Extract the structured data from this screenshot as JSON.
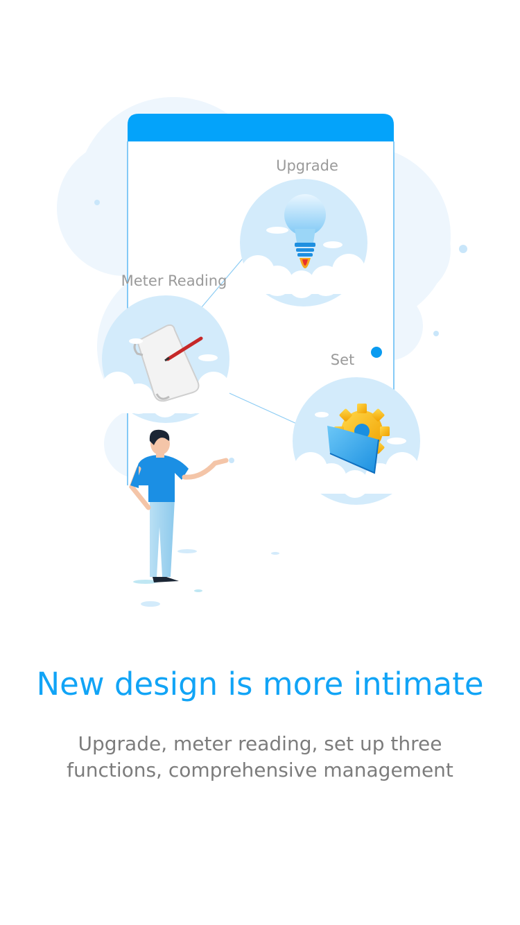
{
  "features": {
    "upgrade": {
      "label": "Upgrade",
      "icon": "lightbulb-rocket-icon"
    },
    "meter_reading": {
      "label": "Meter Reading",
      "icon": "paper-scroll-pen-icon"
    },
    "set": {
      "label": "Set",
      "icon": "folder-gear-icon"
    }
  },
  "headline": "New design is more intimate",
  "description": "Upgrade, meter reading, set up three functions, comprehensive management",
  "colors": {
    "accent": "#11a4f6",
    "phone_header": "#04a3fa",
    "cloud_background": "#eef6fd",
    "bubble": "#d3ebfb",
    "body_text": "#7c7c7c",
    "label_text": "#9a9a9a"
  }
}
